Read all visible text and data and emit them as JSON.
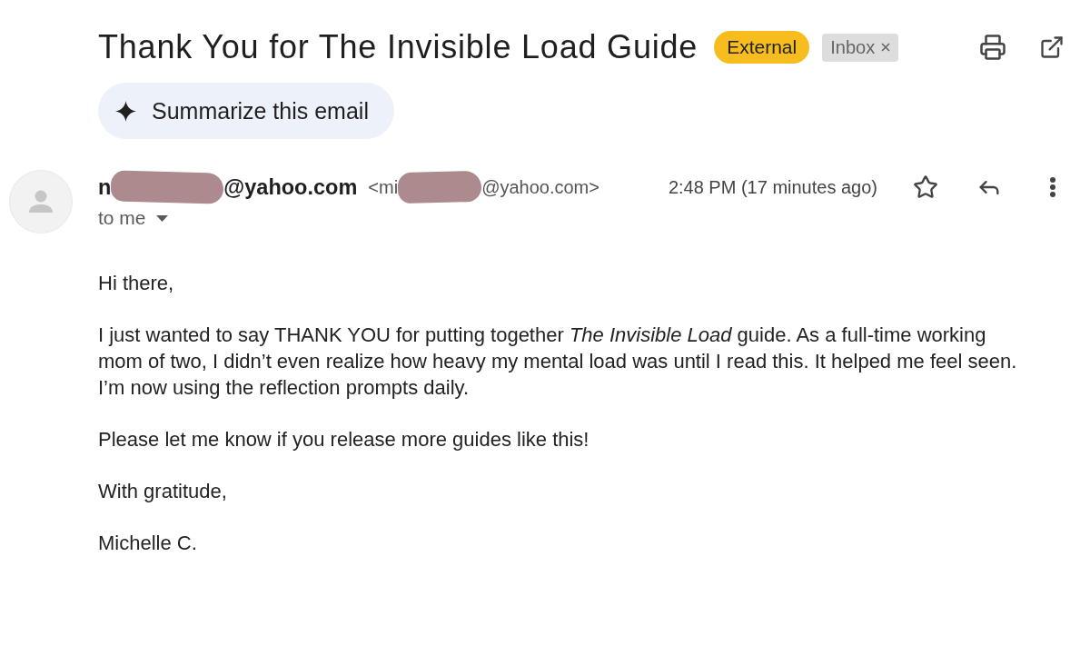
{
  "subject": "Thank You for The Invisible Load Guide",
  "labels": [
    {
      "kind": "external",
      "text": "External",
      "color": "#f7bd1e",
      "removable": false
    },
    {
      "kind": "inbox",
      "text": "Inbox",
      "color": "#dddddd",
      "removable": true
    }
  ],
  "summarize_button": {
    "label": "Summarize this email"
  },
  "sender": {
    "name_parts": [
      "n",
      "@yahoo.com"
    ],
    "address_parts": [
      "<mi",
      "@yahoo.com>"
    ]
  },
  "recipient": "to me",
  "time": "2:48 PM (17 minutes ago)",
  "starred": false,
  "body": [
    "Hi there,",
    "I just wanted to say THANK YOU for putting together *The Invisible Load* guide. As a full-time working mom of two, I didn’t even realize how heavy my mental load was until I read this. It helped me feel seen. I’m now using the reflection prompts daily.",
    "Please let me know if you release more guides like this!",
    "With gratitude,",
    "Michelle C."
  ]
}
